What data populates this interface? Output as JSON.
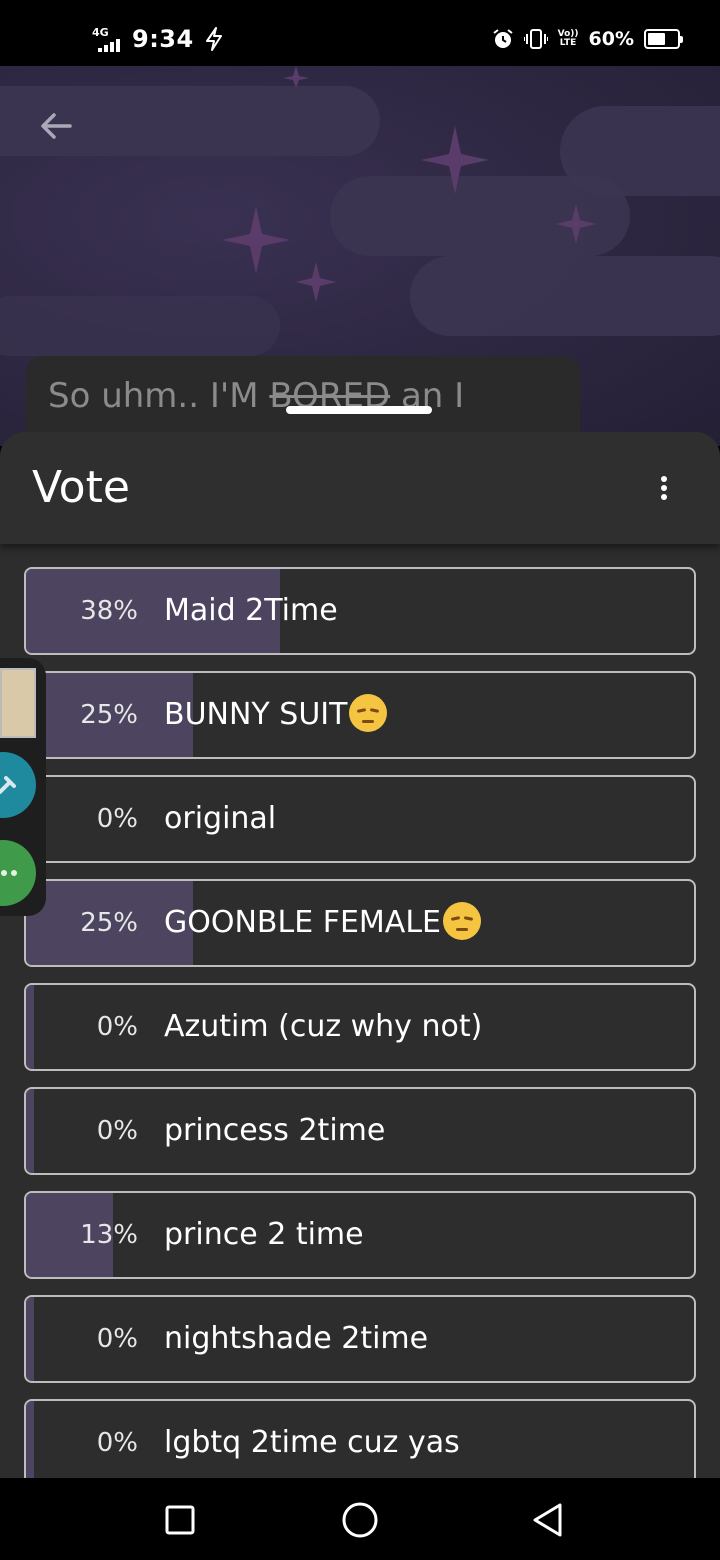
{
  "status_bar": {
    "network_type": "4G",
    "time": "9:34",
    "volte_top": "Vo))",
    "volte_bottom": "LTE",
    "battery_percent": "60%",
    "battery_level": 0.6
  },
  "post": {
    "title_prefix": "So uhm.. I'M ",
    "title_struck": "BORED",
    "title_suffix": " an I"
  },
  "sheet": {
    "title": "Vote"
  },
  "poll": {
    "options": [
      {
        "percent_label": "38%",
        "percent": 38,
        "label": "Maid 2Time",
        "emoji": false
      },
      {
        "percent_label": "25%",
        "percent": 25,
        "label": "BUNNY SUIT",
        "emoji": true
      },
      {
        "percent_label": "0%",
        "percent": 0,
        "label": "original",
        "emoji": false
      },
      {
        "percent_label": "25%",
        "percent": 25,
        "label": "GOONBLE FEMALE",
        "emoji": true
      },
      {
        "percent_label": "0%",
        "percent": 0,
        "label": "Azutim (cuz why not)",
        "emoji": false
      },
      {
        "percent_label": "0%",
        "percent": 0,
        "label": "princess 2time",
        "emoji": false
      },
      {
        "percent_label": "13%",
        "percent": 13,
        "label": "prince 2 time",
        "emoji": false
      },
      {
        "percent_label": "0%",
        "percent": 0,
        "label": "nightshade 2time",
        "emoji": false
      },
      {
        "percent_label": "0%",
        "percent": 0,
        "label": "lgbtq 2time cuz yas",
        "emoji": false
      }
    ]
  },
  "icons": {
    "back": "arrow-left-icon",
    "more": "more-vertical-icon",
    "emoji": "pensive-face-icon",
    "nav_recents": "square-icon",
    "nav_home": "circle-icon",
    "nav_back": "triangle-back-icon"
  },
  "colors": {
    "sheet_bg": "#2d2d2d",
    "result_bar": "#4d4560",
    "option_border": "#bdbdbd"
  }
}
